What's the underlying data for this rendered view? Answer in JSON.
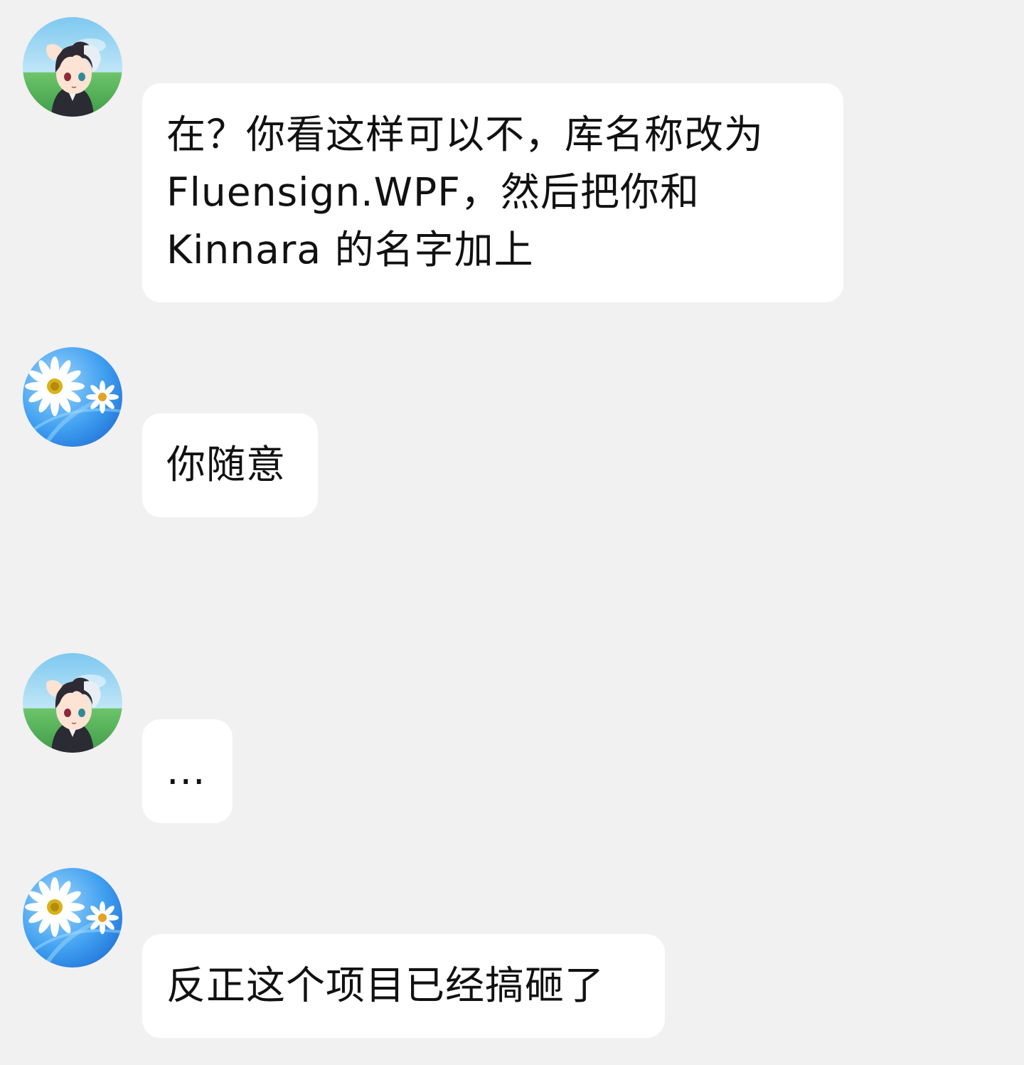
{
  "messages": [
    {
      "sender": "anime-avatar",
      "lines": [
        "在？你看这样可以不，库名称改为",
        "Fluensign.WPF，然后把你和",
        "Kinnara 的名字加上"
      ]
    },
    {
      "sender": "daisy-avatar",
      "lines": [
        "你随意"
      ]
    },
    {
      "sender": "anime-avatar",
      "lines": [
        "..."
      ]
    },
    {
      "sender": "daisy-avatar",
      "lines": [
        "反正这个项目已经搞砸了"
      ]
    }
  ],
  "colors": {
    "background": "#f1f1f1",
    "bubble": "#ffffff",
    "text": "#111111"
  }
}
